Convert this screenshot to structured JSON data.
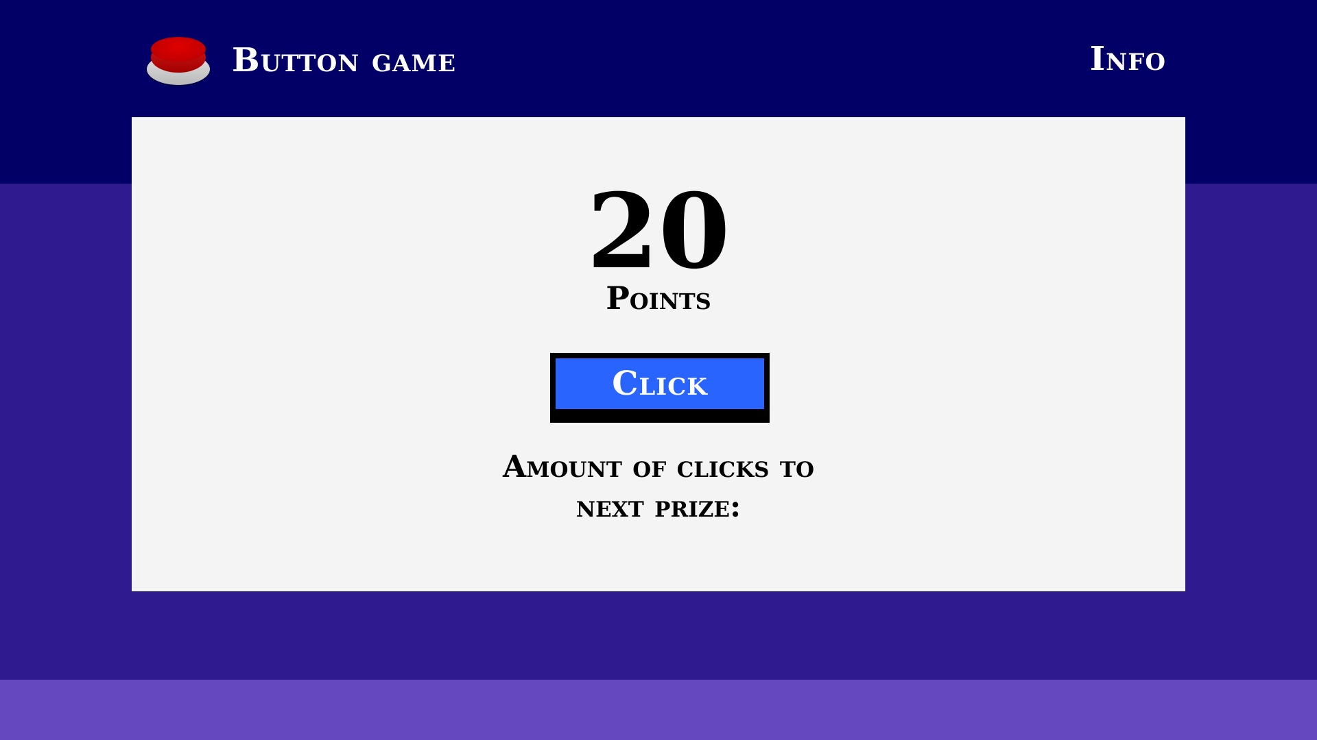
{
  "header": {
    "logo_icon": "red-push-button-icon",
    "title": "Button game",
    "info_label": "Info"
  },
  "game": {
    "score": "20",
    "score_label": "Points",
    "click_label": "Click",
    "prize_line_1": "Amount of clicks to",
    "prize_line_2": "next prize:"
  },
  "colors": {
    "header_bg": "#020066",
    "page_bg": "#2f1b8f",
    "footer_bg": "#6548bf",
    "card_bg": "#f4f4f4",
    "button_bg": "#2a64ff",
    "logo_red": "#c80000"
  }
}
